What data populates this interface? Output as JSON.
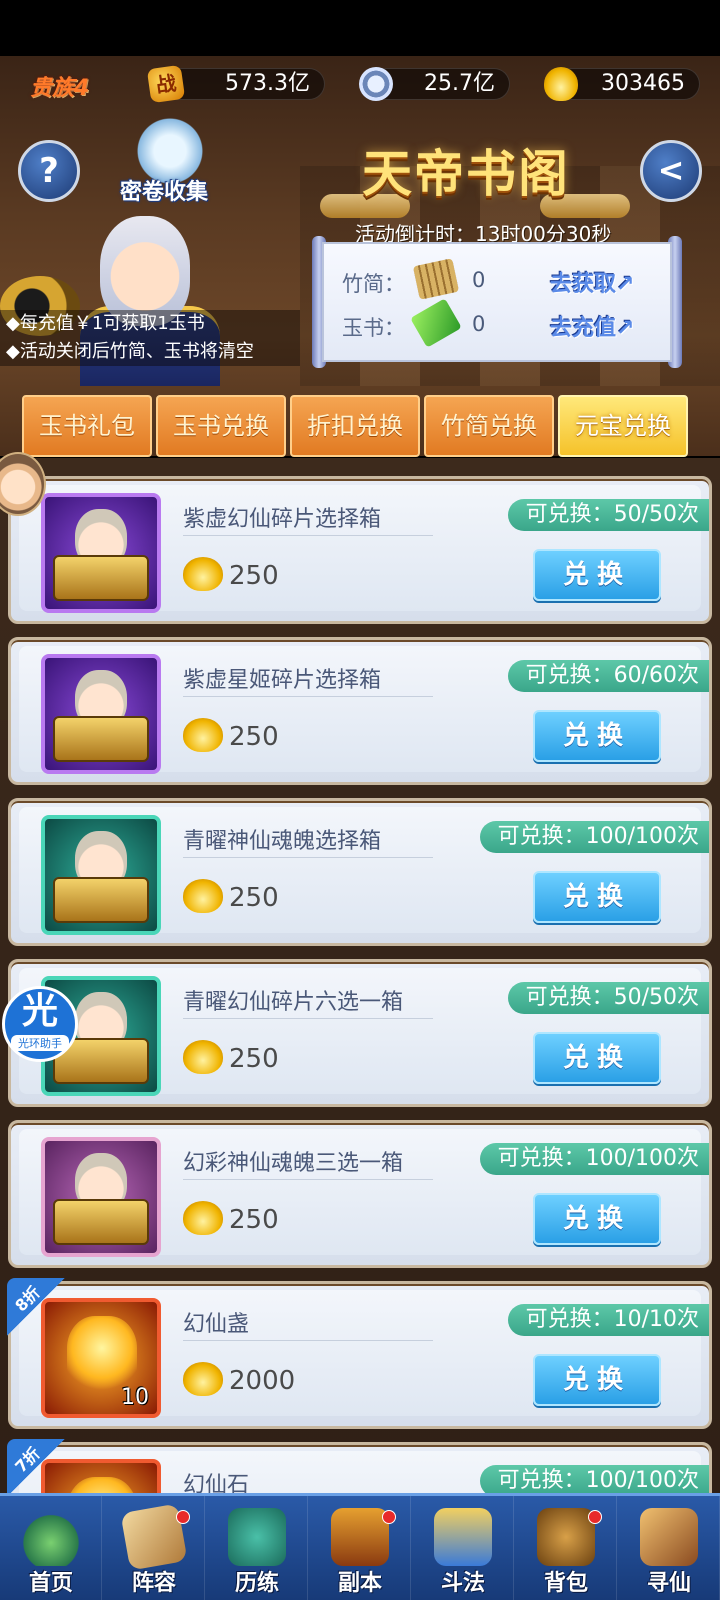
{
  "resources": {
    "vip": "贵族4",
    "battle_icon": "战",
    "battle_power": "573.3亿",
    "coins": "25.7亿",
    "gold": "303465"
  },
  "header": {
    "title": "天帝书阁",
    "collect_label": "密卷收集",
    "help_symbol": "?",
    "back_symbol": "<",
    "countdown": "活动倒计时：13时00分30秒",
    "bamboo_label": "竹简：",
    "bamboo_count": "0",
    "bamboo_action": "去获取↗",
    "jade_label": "玉书：",
    "jade_count": "0",
    "jade_action": "去充值↗",
    "notes": [
      "◆每充值￥1可获取1玉书",
      "◆活动关闭后竹简、玉书将清空"
    ]
  },
  "tabs": [
    {
      "label": "玉书礼包",
      "active": false
    },
    {
      "label": "玉书兑换",
      "active": false
    },
    {
      "label": "折扣兑换",
      "active": false
    },
    {
      "label": "竹简兑换",
      "active": false
    },
    {
      "label": "元宝兑换",
      "active": true
    }
  ],
  "items": [
    {
      "name": "紫虚幻仙碎片选择箱",
      "price": "250",
      "limit": "可兑换：50/50次",
      "button": "兑换",
      "frame": "purple",
      "discount": "",
      "qty": ""
    },
    {
      "name": "紫虚星姬碎片选择箱",
      "price": "250",
      "limit": "可兑换：60/60次",
      "button": "兑换",
      "frame": "purple",
      "discount": "",
      "qty": ""
    },
    {
      "name": "青曜神仙魂魄选择箱",
      "price": "250",
      "limit": "可兑换：100/100次",
      "button": "兑换",
      "frame": "teal",
      "discount": "",
      "qty": ""
    },
    {
      "name": "青曜幻仙碎片六选一箱",
      "price": "250",
      "limit": "可兑换：50/50次",
      "button": "兑换",
      "frame": "teal",
      "discount": "",
      "qty": ""
    },
    {
      "name": "幻彩神仙魂魄三选一箱",
      "price": "250",
      "limit": "可兑换：100/100次",
      "button": "兑换",
      "frame": "pink",
      "discount": "",
      "qty": ""
    },
    {
      "name": "幻仙盏",
      "price": "2000",
      "limit": "可兑换：10/10次",
      "button": "兑换",
      "frame": "red",
      "discount": "8折",
      "qty": "10"
    },
    {
      "name": "幻仙石",
      "price": "",
      "limit": "可兑换：100/100次",
      "button": "",
      "frame": "red",
      "discount": "7折",
      "qty": ""
    }
  ],
  "helper": {
    "big": "光",
    "small": "光环助手"
  },
  "nav": [
    {
      "label": "首页",
      "icon": "home-icon",
      "dot": false
    },
    {
      "label": "阵容",
      "icon": "lineup-icon",
      "dot": true
    },
    {
      "label": "历练",
      "icon": "training-icon",
      "dot": false
    },
    {
      "label": "副本",
      "icon": "dungeon-icon",
      "dot": true
    },
    {
      "label": "斗法",
      "icon": "battle-icon",
      "dot": false
    },
    {
      "label": "背包",
      "icon": "bag-icon",
      "dot": true
    },
    {
      "label": "寻仙",
      "icon": "seek-immortal-icon",
      "dot": false
    }
  ]
}
